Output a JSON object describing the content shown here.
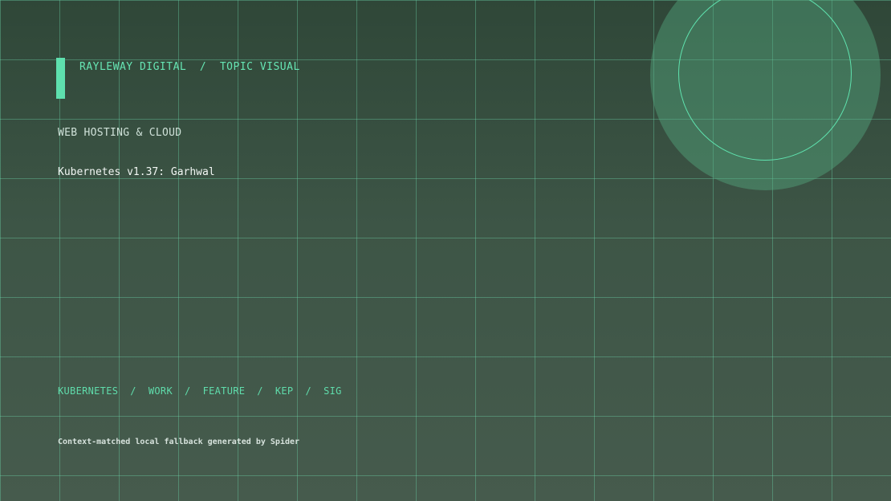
{
  "header": {
    "eyebrow": "RAYLEWAY DIGITAL  /  TOPIC VISUAL"
  },
  "content": {
    "category": "WEB HOSTING & CLOUD",
    "title": "Kubernetes v1.37: Garhwal",
    "tags": "KUBERNETES  /  WORK  /  FEATURE  /  KEP  /  SIG",
    "footnote": "Context-matched local fallback generated by Spider"
  },
  "colors": {
    "accent": "#5ee0ae",
    "background_top": "#2f4738",
    "background_bottom": "#465b4d",
    "grid_line": "#6cd6aa"
  }
}
